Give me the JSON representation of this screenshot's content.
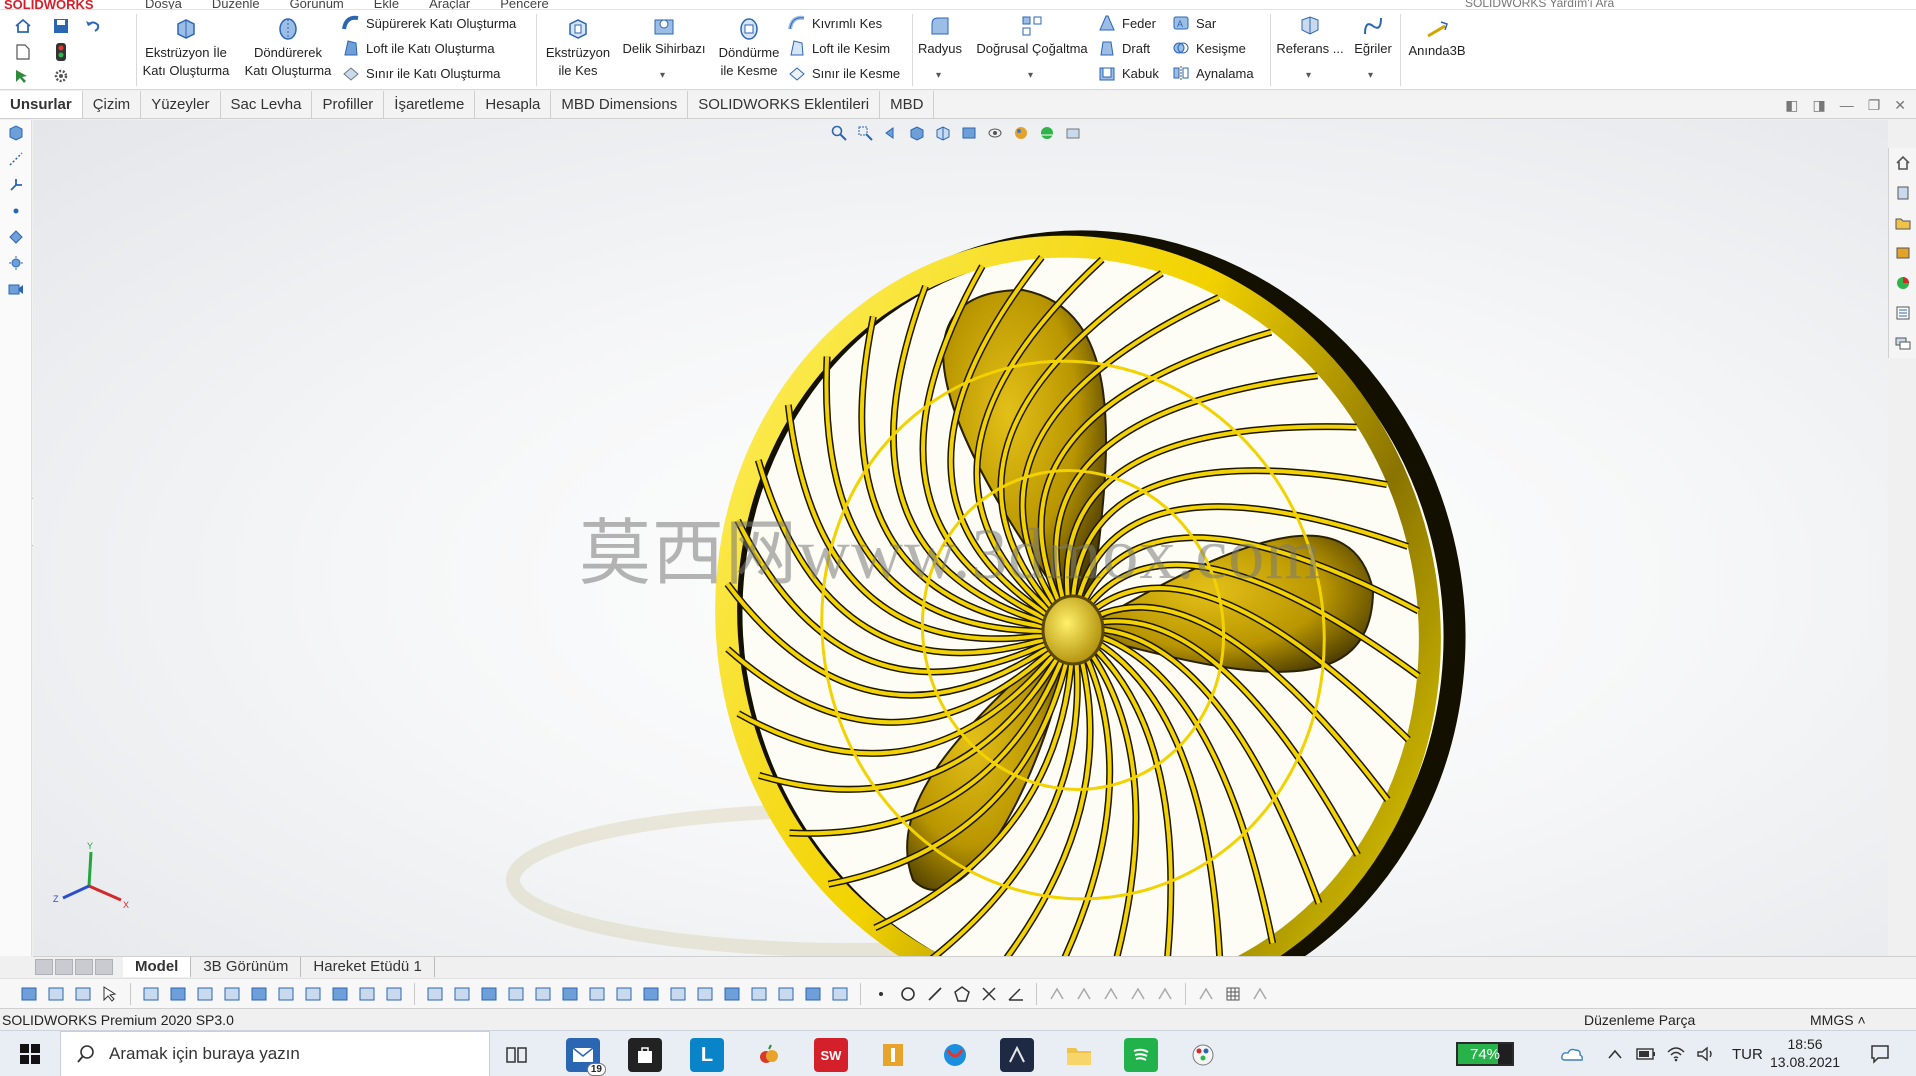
{
  "app": {
    "logo_text": "SOLIDWORKS",
    "menus": [
      "Dosya",
      "Düzenle",
      "Görünüm",
      "Ekle",
      "Araçlar",
      "Pencere"
    ],
    "help_search": "SOLIDWORKS Yardım'ı Ara"
  },
  "ribbon": {
    "extrude_boss": [
      "Ekstrüzyon İle",
      "Katı Oluşturma"
    ],
    "revolve_boss": [
      "Döndürerek",
      "Katı Oluşturma"
    ],
    "swept_boss": "Süpürerek Katı Oluşturma",
    "loft_boss": "Loft ile Katı Oluşturma",
    "boundary_boss": "Sınır ile Katı Oluşturma",
    "extrude_cut": [
      "Ekstrüzyon",
      "ile Kes"
    ],
    "hole_wizard": "Delik Sihirbazı",
    "revolve_cut": [
      "Döndürme",
      "ile Kesme"
    ],
    "swept_cut": "Kıvrımlı Kes",
    "loft_cut": "Loft ile Kesim",
    "boundary_cut": "Sınır ile Kesme",
    "fillet": "Radyus",
    "linear_pattern": "Doğrusal Çoğaltma",
    "rib": "Feder",
    "draft": "Draft",
    "shell": "Kabuk",
    "wrap": "Sar",
    "intersect": "Kesişme",
    "mirror": "Aynalama",
    "reference": "Referans ...",
    "curves": "Eğriler",
    "instant3d": "Anında3B"
  },
  "tabs": [
    "Unsurlar",
    "Çizim",
    "Yüzeyler",
    "Sac Levha",
    "Profiller",
    "İşaretleme",
    "Hesapla",
    "MBD Dimensions",
    "SOLIDWORKS Eklentileri",
    "MBD"
  ],
  "active_tab": "Unsurlar",
  "viewport": {
    "watermark": "莫西网www.3dmox.com",
    "triad": {
      "x": "X",
      "y": "Y",
      "z": "Z"
    }
  },
  "bottom_tabs": [
    "Model",
    "3B Görünüm",
    "Hareket Etüdü 1"
  ],
  "status": {
    "left": "SOLIDWORKS Premium 2020 SP3.0",
    "mode": "Düzenleme Parça",
    "units": "MMGS"
  },
  "taskbar": {
    "search_placeholder": "Aramak için buraya yazın",
    "mail_badge": "19",
    "app_sw_label": "SW",
    "app_l_label": "L",
    "battery_percent": 74,
    "battery_label": "74%",
    "language": "TUR",
    "time": "18:56",
    "date": "13.08.2021"
  },
  "colors": {
    "fan_yellow": "#f2d200",
    "fan_dark": "#1c1600",
    "accent_blue": "#2b66b2",
    "brand_red": "#d4202a"
  }
}
